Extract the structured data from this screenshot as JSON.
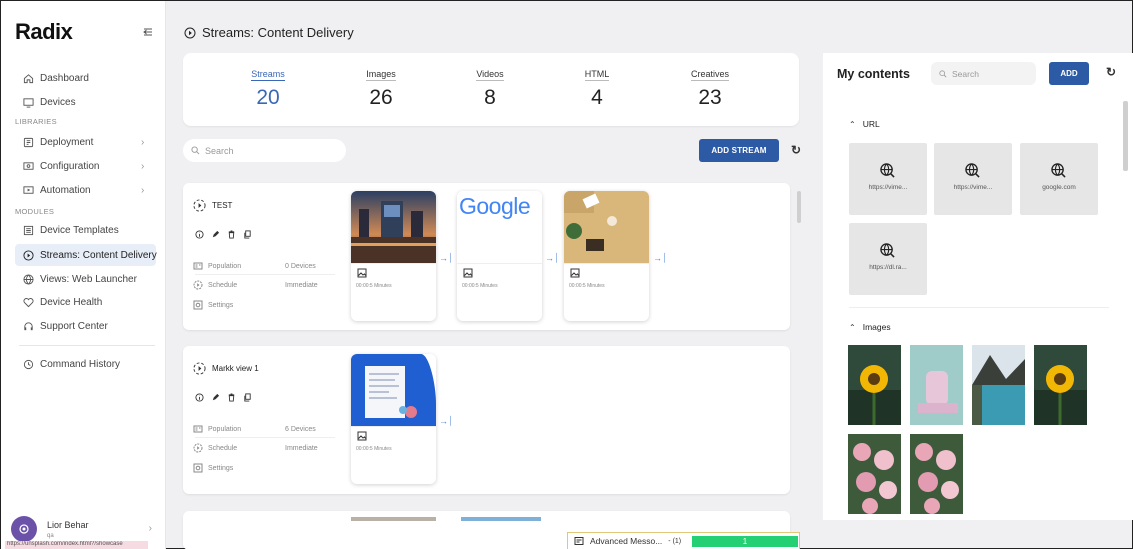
{
  "app": {
    "logo": "Radix"
  },
  "sidebar": {
    "items_top": [
      {
        "label": "Dashboard",
        "icon": "home-icon"
      },
      {
        "label": "Devices",
        "icon": "monitor-icon"
      }
    ],
    "libraries_label": "LIBRARIES",
    "libraries": [
      {
        "label": "Deployment",
        "icon": "deployment-icon"
      },
      {
        "label": "Configuration",
        "icon": "configuration-icon"
      },
      {
        "label": "Automation",
        "icon": "automation-icon"
      }
    ],
    "modules_label": "MODULES",
    "modules": [
      {
        "label": "Device Templates",
        "icon": "template-icon"
      },
      {
        "label": "Streams: Content Delivery",
        "icon": "play-circle-icon",
        "active": true
      },
      {
        "label": "Views: Web Launcher",
        "icon": "globe-icon"
      },
      {
        "label": "Device Health",
        "icon": "heart-icon"
      },
      {
        "label": "Support Center",
        "icon": "headset-icon"
      }
    ],
    "command_history": "Command History",
    "user": {
      "name": "Lior Behar",
      "sub": "qa"
    },
    "status_url": "https://unsplash.com/index.html?/showcase"
  },
  "page": {
    "title": "Streams: Content Delivery"
  },
  "stats": [
    {
      "label": "Streams",
      "value": "20",
      "active": true
    },
    {
      "label": "Images",
      "value": "26"
    },
    {
      "label": "Videos",
      "value": "8"
    },
    {
      "label": "HTML",
      "value": "4"
    },
    {
      "label": "Creatives",
      "value": "23"
    }
  ],
  "toolbar": {
    "search_placeholder": "Search",
    "add_stream_label": "ADD STREAM"
  },
  "streams": [
    {
      "name": "TEST",
      "population_label": "Population",
      "population_value": "0 Devices",
      "schedule_label": "Schedule",
      "schedule_value": "Immediate",
      "settings_label": "Settings",
      "contents": [
        {
          "kind": "city-photo",
          "duration": "00:00:5 Minutes"
        },
        {
          "kind": "google-logo",
          "duration": "00:00:5 Minutes",
          "logo_text": "Google"
        },
        {
          "kind": "desk-photo",
          "duration": "00:00:5 Minutes"
        }
      ]
    },
    {
      "name": "Markk view 1",
      "population_label": "Population",
      "population_value": "6 Devices",
      "schedule_label": "Schedule",
      "schedule_value": "Immediate",
      "settings_label": "Settings",
      "contents": [
        {
          "kind": "document-screenshot",
          "duration": "00:00:5 Minutes"
        }
      ]
    }
  ],
  "my_contents": {
    "title": "My contents",
    "search_placeholder": "Search",
    "add_label": "ADD",
    "url_group": "URL",
    "urls": [
      "https://vime...",
      "https://vime...",
      "google.com",
      "https://dl.ra..."
    ],
    "images_group": "Images",
    "images": [
      "sunflower",
      "pink-sculpture",
      "mountain-lake",
      "sunflower",
      "pink-flowers",
      "pink-flowers"
    ]
  },
  "toast": {
    "label": "Advanced Messo...",
    "count": "- (1)",
    "progress_text": "1"
  },
  "colors": {
    "accent": "#2c5aa5",
    "active_text": "#3a68b8",
    "progress": "#25d075"
  }
}
